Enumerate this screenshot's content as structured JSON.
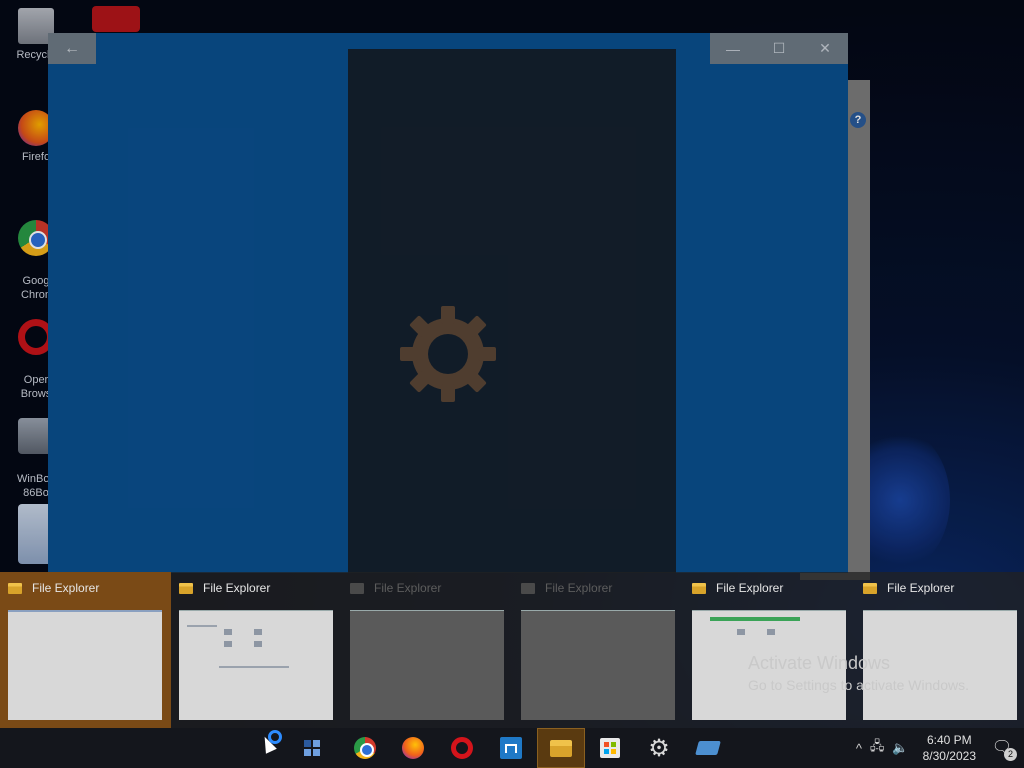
{
  "desktop": {
    "icons": [
      {
        "label": "Recycle",
        "icon": "recycle-bin-icon"
      },
      {
        "label": "Firefo",
        "icon": "firefox-icon"
      },
      {
        "label": "Goog\nChron",
        "icon": "chrome-icon"
      },
      {
        "label": "Oper\nBrows",
        "icon": "opera-icon"
      },
      {
        "label": "WinBox\n86Bo",
        "icon": "winbox-icon"
      }
    ]
  },
  "app_window": {
    "back_glyph": "←",
    "minimize_glyph": "—",
    "maximize_glyph": "☐",
    "close_glyph": "✕"
  },
  "background_window": {
    "help_glyph": "?"
  },
  "switcher": {
    "items": [
      {
        "title": "File Explorer",
        "state": "selected"
      },
      {
        "title": "File Explorer",
        "state": "normal"
      },
      {
        "title": "File Explorer",
        "state": "dim"
      },
      {
        "title": "File Explorer",
        "state": "dim"
      },
      {
        "title": "File Explorer",
        "state": "normal"
      },
      {
        "title": "File Explorer",
        "state": "normal"
      }
    ]
  },
  "watermark": {
    "line1": "Activate Windows",
    "line2": "Go to Settings to activate Windows."
  },
  "taskbar": {
    "pinned": [
      "cortana-icon",
      "task-view-icon",
      "chrome-icon",
      "firefox-icon",
      "opera-icon",
      "winbox-icon",
      "file-explorer-icon",
      "store-icon",
      "settings-icon",
      "misc-app-icon"
    ],
    "tray": {
      "chevron": "^",
      "time": "6:40 PM",
      "date": "8/30/2023",
      "notification_count": "2"
    }
  },
  "colors": {
    "accent_window": "#0a4f8e",
    "selected_thumb": "#7a4a16",
    "taskbar": "#14161c"
  }
}
